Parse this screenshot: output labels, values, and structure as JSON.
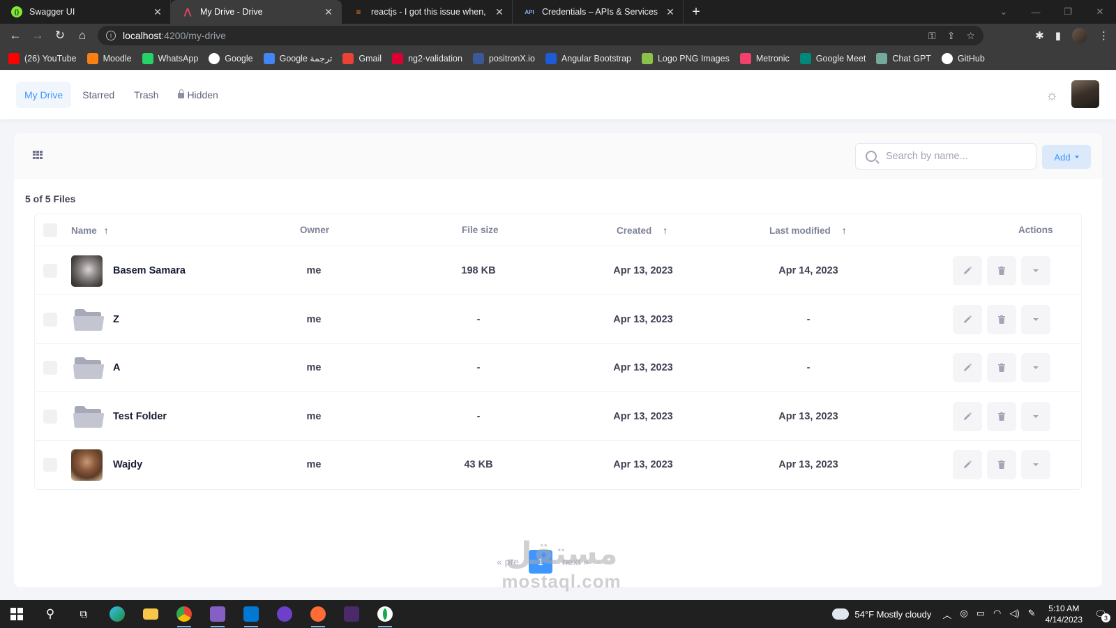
{
  "browser": {
    "tabs": [
      {
        "title": "Swagger UI",
        "icon": "swagger-icon",
        "color": "#85ea2d",
        "active": false
      },
      {
        "title": "My Drive - Drive",
        "icon": "metronic-icon",
        "color": "#f1416c",
        "active": true
      },
      {
        "title": "reactjs - I got this issue when, I a",
        "icon": "stackoverflow-icon",
        "color": "#f48024",
        "active": false
      },
      {
        "title": "Credentials – APIs & Services – M",
        "icon": "api-icon",
        "color": "#8ab4f8",
        "active": false
      }
    ],
    "url_host": "localhost",
    "url_path": ":4200/my-drive",
    "bookmarks": [
      {
        "label": "(26) YouTube",
        "color": "#ff0000"
      },
      {
        "label": "Moodle",
        "color": "#f98012"
      },
      {
        "label": "WhatsApp",
        "color": "#25d366"
      },
      {
        "label": "Google",
        "color": "#ffffff"
      },
      {
        "label": "Google ترجمة",
        "color": "#4285f4"
      },
      {
        "label": "Gmail",
        "color": "#ea4335"
      },
      {
        "label": "ng2-validation",
        "color": "#dd0031"
      },
      {
        "label": "positronX.io",
        "color": "#3b5998"
      },
      {
        "label": "Angular Bootstrap",
        "color": "#1e5bd8"
      },
      {
        "label": "Logo PNG Images",
        "color": "#8bc34a"
      },
      {
        "label": "Metronic",
        "color": "#f1416c"
      },
      {
        "label": "Google Meet",
        "color": "#00897b"
      },
      {
        "label": "Chat GPT",
        "color": "#74aa9c"
      },
      {
        "label": "GitHub",
        "color": "#ffffff"
      }
    ]
  },
  "app": {
    "nav": [
      {
        "label": "My Drive",
        "active": true
      },
      {
        "label": "Starred",
        "active": false
      },
      {
        "label": "Trash",
        "active": false
      },
      {
        "label": "Hidden",
        "active": false
      }
    ],
    "theme_icon": "sun-icon",
    "accent_color": "#3e97ff"
  },
  "toolbar": {
    "search_placeholder": "Search by name...",
    "add_label": "Add"
  },
  "files_count": "5 of 5 Files",
  "table": {
    "columns": {
      "name": "Name",
      "owner": "Owner",
      "file_size": "File size",
      "created": "Created",
      "last_modified": "Last modified",
      "actions": "Actions"
    },
    "rows": [
      {
        "type": "image",
        "name": "Basem Samara",
        "owner": "me",
        "size": "198 KB",
        "created": "Apr 13, 2023",
        "modified": "Apr 14, 2023"
      },
      {
        "type": "folder",
        "name": "Z",
        "owner": "me",
        "size": "-",
        "created": "Apr 13, 2023",
        "modified": "-"
      },
      {
        "type": "folder",
        "name": "A",
        "owner": "me",
        "size": "-",
        "created": "Apr 13, 2023",
        "modified": "-"
      },
      {
        "type": "folder",
        "name": "Test Folder",
        "owner": "me",
        "size": "-",
        "created": "Apr 13, 2023",
        "modified": "Apr 13, 2023"
      },
      {
        "type": "image",
        "name": "Wajdy",
        "owner": "me",
        "size": "43 KB",
        "created": "Apr 13, 2023",
        "modified": "Apr 13, 2023"
      }
    ]
  },
  "pagination": {
    "prev_label": "« pre",
    "current": "1",
    "next_label": "next »"
  },
  "watermark": {
    "arabic": "مستقل",
    "latin": "mostaql.com"
  },
  "taskbar": {
    "weather": "54°F  Mostly cloudy",
    "time": "5:10 AM",
    "date": "4/14/2023",
    "notifications": "3"
  }
}
